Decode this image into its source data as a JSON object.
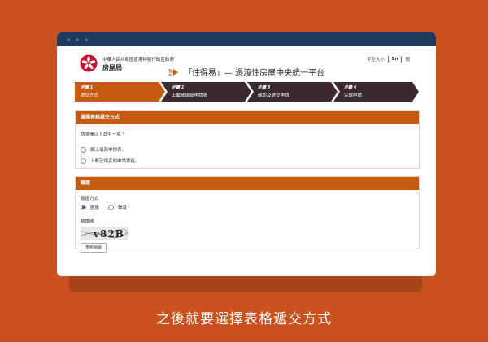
{
  "header": {
    "gov_name": "中華人民共和國香港特別行政區政府",
    "dept_name": "房屋局",
    "font_size_label": "字型大小",
    "lang_en": "En",
    "lang_sc": "簡"
  },
  "platform_title": "「住得易」— 過渡性房屋中央統一平台",
  "steps": [
    {
      "num": "步驟 1",
      "label": "遞交方式",
      "active": true
    },
    {
      "num": "步驟 2",
      "label": "上載或填寫申請表",
      "active": false
    },
    {
      "num": "步驟 3",
      "label": "確認及遞交申請",
      "active": false
    },
    {
      "num": "步驟 4",
      "label": "完成申請",
      "active": false
    }
  ],
  "form_method": {
    "heading": "選擇表格遞交方式",
    "prompt": "請選擇以下其中一項",
    "required_mark": "*",
    "options": [
      "網上填寫申請表。",
      "上載已填妥的申請表格。"
    ]
  },
  "verification": {
    "heading": "驗證",
    "method_label": "驗證方式",
    "methods": [
      "圖像",
      "聲音"
    ],
    "selected_method": 0,
    "code_label": "驗證碼",
    "captcha_text": "v82B",
    "refresh_label": "重新繪圖"
  },
  "subtitle": "之後就要選擇表格遞交方式",
  "colors": {
    "background": "#c9521f",
    "active_step": "#c55a11",
    "inactive_step": "#3b2b2e",
    "titlebar": "#1e3a5f"
  }
}
